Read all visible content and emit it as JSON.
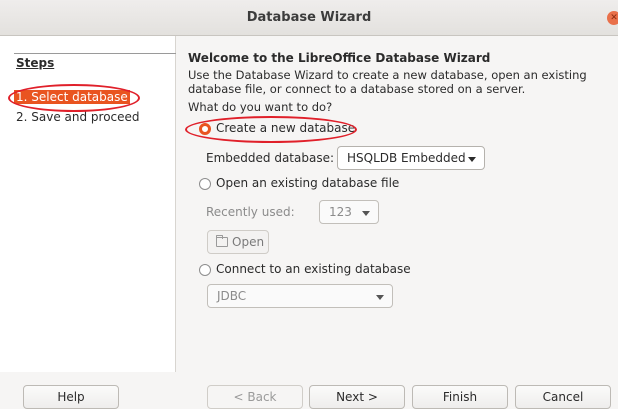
{
  "window": {
    "title": "Database Wizard"
  },
  "sidebar": {
    "heading": "Steps",
    "items": [
      {
        "label": "1. Select database",
        "active": true
      },
      {
        "label": "2. Save and proceed",
        "active": false
      }
    ]
  },
  "main": {
    "heading": "Welcome to the LibreOffice Database Wizard",
    "description": "Use the Database Wizard to create a new database, open an existing database file, or connect to a database stored on a server.",
    "question": "What do you want to do?",
    "option_create": "Create a new database",
    "embedded_label": "Embedded database:",
    "embedded_value": "HSQLDB Embedded",
    "option_open": "Open an existing database file",
    "recent_label": "Recently used:",
    "recent_value": "123",
    "open_button": "Open",
    "option_connect": "Connect to an existing database",
    "connect_value": "JDBC"
  },
  "buttons": {
    "help": "Help",
    "back": "< Back",
    "next": "Next >",
    "finish": "Finish",
    "cancel": "Cancel"
  },
  "colors": {
    "accent": "#e95420",
    "annotation": "#e0202a"
  }
}
